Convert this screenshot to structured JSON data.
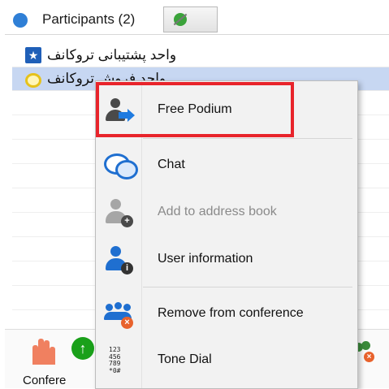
{
  "header": {
    "participants_label": "Participants (2)"
  },
  "participants": [
    {
      "name": "واحد پشتیبانی تروکانف",
      "icon": "star-icon"
    },
    {
      "name": "واحد فروش تروکانف",
      "icon": "token-icon"
    }
  ],
  "context_menu": {
    "items": [
      {
        "label": "Free Podium",
        "icon": "free-podium-icon",
        "enabled": true
      },
      {
        "label": "Chat",
        "icon": "chat-bubbles-icon",
        "enabled": true
      },
      {
        "label": "Add to address book",
        "icon": "add-contact-icon",
        "enabled": false
      },
      {
        "label": "User information",
        "icon": "user-info-icon",
        "enabled": true
      },
      {
        "label": "Remove from conference",
        "icon": "remove-group-icon",
        "enabled": true
      },
      {
        "label": "Tone Dial",
        "icon": "keypad-icon",
        "enabled": true
      }
    ]
  },
  "bottom": {
    "conference_label_partial": "Confere"
  },
  "colors": {
    "highlight_border": "#e8242b",
    "selected_row": "#c7d7f2",
    "accent_blue": "#2f7fd6"
  }
}
